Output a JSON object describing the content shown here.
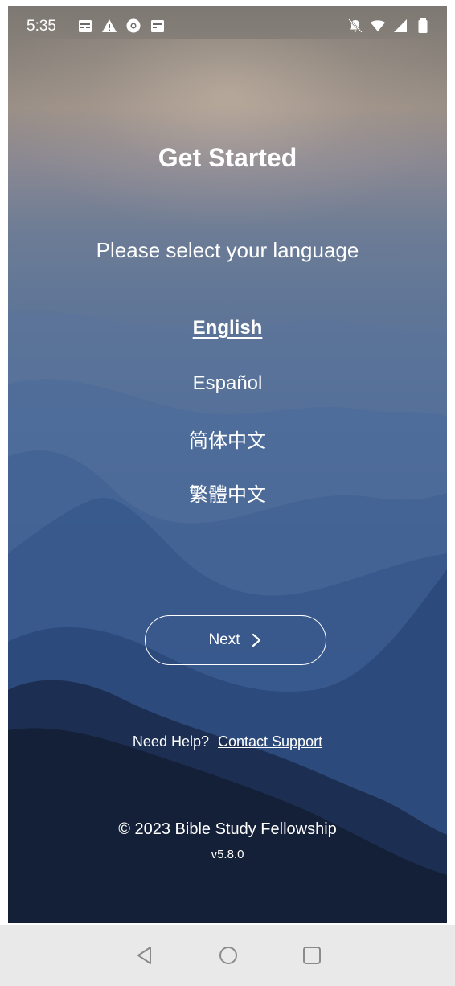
{
  "status_bar": {
    "time": "5:35",
    "left_icons": [
      "calendar-icon",
      "warning-icon",
      "chrome-icon",
      "calendar-icon"
    ],
    "right_icons": [
      "notifications-off-icon",
      "wifi-icon",
      "signal-icon",
      "battery-icon"
    ]
  },
  "header": {
    "title": "Get Started",
    "subtitle": "Please select your language"
  },
  "languages": [
    {
      "label": "English",
      "selected": true
    },
    {
      "label": "Español",
      "selected": false
    },
    {
      "label": "简体中文",
      "selected": false
    },
    {
      "label": "繁體中文",
      "selected": false
    }
  ],
  "next_button": {
    "label": "Next",
    "icon": "chevron-right-icon"
  },
  "help": {
    "prefix": "Need Help?",
    "link": "Contact Support"
  },
  "footer": {
    "copyright": "© 2023 Bible Study Fellowship",
    "version": "v5.8.0"
  },
  "nav_bar": {
    "buttons": [
      "back-icon",
      "home-icon",
      "recents-icon"
    ]
  },
  "colors": {
    "text": "#ffffff",
    "nav_bar_bg": "#e9e9e9",
    "nav_icon": "#8a8a8a"
  }
}
